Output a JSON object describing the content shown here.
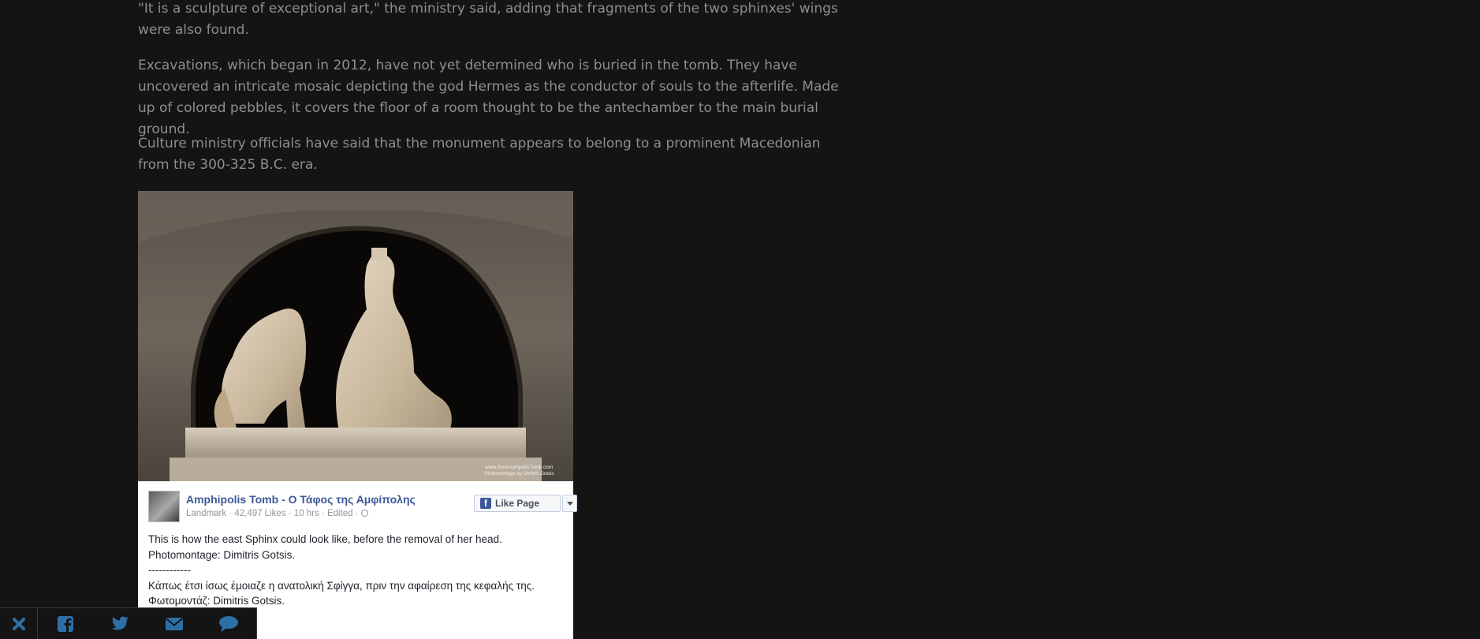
{
  "article": {
    "paragraphs": [
      "\"It is a sculpture of exceptional art,\" the ministry said, adding that fragments of the two sphinxes' wings were also found.",
      "Excavations, which began in 2012, have not yet determined who is buried in the tomb. They have uncovered an intricate mosaic depicting the god Hermes as the conductor of souls to the afterlife. Made up of colored pebbles, it covers the floor of a room thought to be the antechamber to the main burial ground.",
      "Culture ministry officials have said that the monument appears to belong to a prominent Macedonian from the 300-325 B.C. era."
    ]
  },
  "photo": {
    "watermark_line1": "www.theAmphipolisTomb.com",
    "watermark_line2": "Photomontage by Dimitris Gotsis"
  },
  "fb_embed": {
    "page_name": "Amphipolis Tomb - Ο Τάφος της Αμφίπολης",
    "meta": "Landmark · 42,497 Likes · 10 hrs · Edited ·",
    "like_button": "Like Page",
    "post_lines": [
      "This is how the east Sphinx could look like, before the removal of her head.",
      "Photomontage: Dimitris Gotsis.",
      "------------",
      "Κάπως έτσι ίσως έμοιαζε η ανατολική Σφίγγα, πριν την αφαίρεση της κεφαλής της.",
      "Φωτομοντάζ: Dimitris Gotsis."
    ]
  },
  "share_bar": {
    "icons": [
      "close-icon",
      "facebook-icon",
      "twitter-icon",
      "email-icon",
      "comment-icon"
    ],
    "icon_color": "#2e6fa8"
  },
  "colors": {
    "background": "#141414",
    "body_text": "#8e8e8e",
    "fb_link": "#3b5998"
  }
}
